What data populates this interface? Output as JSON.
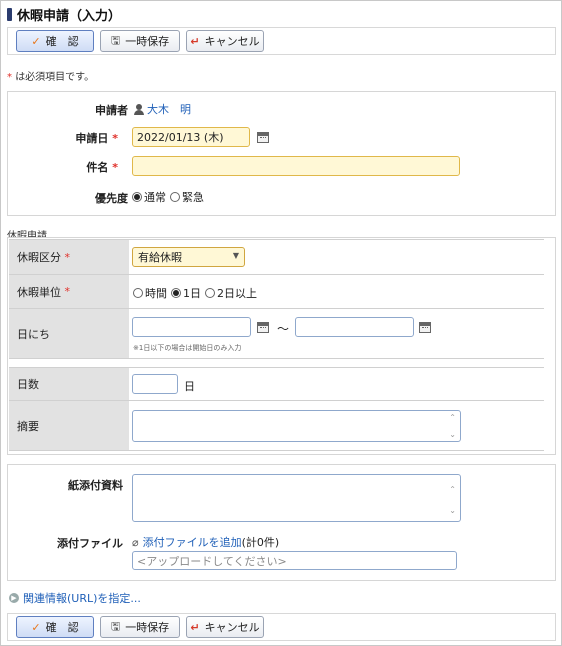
{
  "page": {
    "title": "休暇申請（入力）",
    "required_note": "は必須項目です。",
    "required_mark": "*"
  },
  "toolbar": {
    "confirm_label": "確　認",
    "save_label": "一時保存",
    "cancel_label": "キャンセル"
  },
  "form": {
    "applicant_label": "申請者",
    "applicant_value": "大木　明",
    "date_label": "申請日",
    "date_value": "2022/01/13 (木)",
    "subject_label": "件名",
    "subject_value": "",
    "priority_label": "優先度",
    "priority_options": [
      "通常",
      "緊急"
    ],
    "priority_selected": "通常"
  },
  "leave": {
    "section_title": "休暇申請",
    "type_label": "休暇区分",
    "type_value": "有給休暇",
    "unit_label": "休暇単位",
    "unit_options": [
      "時間",
      "1日",
      "2日以上"
    ],
    "unit_selected": "1日",
    "date_label": "日にち",
    "date_separator": "～",
    "date_hint": "※1日以下の場合は開始日のみ入力",
    "days_label": "日数",
    "days_unit": "日",
    "days_value": "",
    "summary_label": "摘要",
    "summary_value": ""
  },
  "attach": {
    "paper_label": "紙添付資料",
    "file_label": "添付ファイル",
    "add_link": "添付ファイルを追加",
    "file_count": "(計0件)",
    "upload_placeholder": "<アップロードしてください>"
  },
  "related": {
    "link_label": "関連情報(URL)を指定..."
  }
}
